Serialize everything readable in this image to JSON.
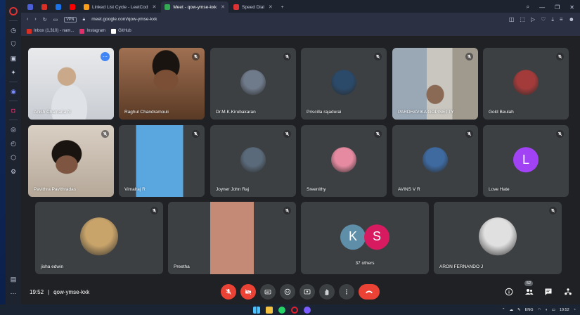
{
  "browser": {
    "tabs": [
      {
        "label": "",
        "fav": "#4b5fd6",
        "active": false,
        "icon": "messenger-icon"
      },
      {
        "label": "",
        "fav": "#d93025",
        "active": false,
        "icon": "gmail-icon"
      },
      {
        "label": "",
        "fav": "#1a73e8",
        "active": false,
        "icon": "mail-icon"
      },
      {
        "label": "",
        "fav": "#ff0000",
        "active": false,
        "icon": "youtube-icon"
      },
      {
        "label": "Linked List Cycle - LeetCod",
        "fav": "#f89f1b",
        "active": false,
        "icon": "leetcode-icon"
      },
      {
        "label": "Meet - qow-ymse-kxk",
        "fav": "#34a853",
        "active": true,
        "icon": "meet-icon"
      },
      {
        "label": "Speed Dial",
        "fav": "#d33",
        "active": false,
        "icon": "opera-icon"
      }
    ],
    "url": "meet.google.com/qow-ymse-kxk",
    "vpn_label": "VPN",
    "bookmarks": [
      {
        "label": "Inbox (1,310) - nam...",
        "color": "#d93025",
        "icon": "gmail-icon"
      },
      {
        "label": "Instagram",
        "color": "#e1306c",
        "icon": "instagram-icon"
      },
      {
        "label": "GitHub",
        "color": "#ffffff",
        "icon": "github-icon"
      }
    ]
  },
  "meet": {
    "participants": [
      {
        "name": "Anish Chamaria N",
        "kind": "video",
        "speaking": true
      },
      {
        "name": "Raghul Chandramouli",
        "kind": "video"
      },
      {
        "name": "Dr.M.K.Kirubakaran",
        "kind": "avatar",
        "color": "#6f7a8a"
      },
      {
        "name": "Priscilla rajadurai",
        "kind": "avatar",
        "color": "#2b4a6a"
      },
      {
        "name": "PARDHAVIKA GOPISETTY",
        "kind": "video"
      },
      {
        "name": "Gold Beulah",
        "kind": "avatar",
        "color": "#a33b3b"
      },
      {
        "name": "Pavithra Pavithradas",
        "kind": "video"
      },
      {
        "name": "Vimalraj R",
        "kind": "video"
      },
      {
        "name": "Joyner John Raj",
        "kind": "avatar",
        "color": "#5a6a7a"
      },
      {
        "name": "Sreenithy",
        "kind": "avatar",
        "color": "#e58aa0"
      },
      {
        "name": "AVINS V R",
        "kind": "avatar",
        "color": "#3e6aa0"
      },
      {
        "name": "Love Hate",
        "kind": "letter",
        "letter": "L",
        "color": "#a142f4"
      },
      {
        "name": "jisha edwin",
        "kind": "avatar",
        "color": "#c9a46a"
      },
      {
        "name": "Preetha",
        "kind": "video"
      },
      {
        "name": "37 others",
        "kind": "others",
        "letters": [
          "K",
          "S"
        ],
        "colors": [
          "#5f8fa8",
          "#d81b60"
        ]
      },
      {
        "name": "ARON FERNANDO J",
        "kind": "avatar",
        "color": "#e0e0e0"
      }
    ],
    "time": "19:52",
    "separator": "|",
    "code": "qow-ymse-kxk",
    "people_count": "52"
  },
  "taskbar": {
    "lang": "ENG",
    "time": "19:52",
    "date": ""
  }
}
